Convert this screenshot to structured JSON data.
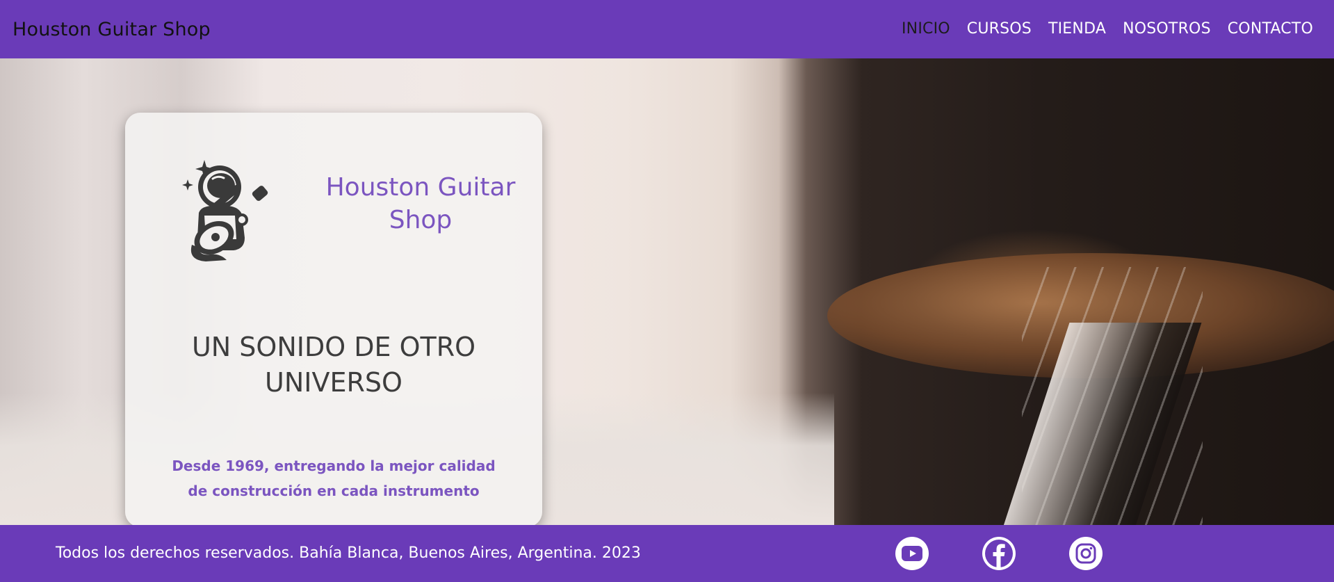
{
  "header": {
    "brand": "Houston Guitar Shop",
    "nav": [
      {
        "label": "INICIO",
        "active": true
      },
      {
        "label": "CURSOS",
        "active": false
      },
      {
        "label": "TIENDA",
        "active": false
      },
      {
        "label": "NOSOTROS",
        "active": false
      },
      {
        "label": "CONTACTO",
        "active": false
      }
    ]
  },
  "card": {
    "title": "Houston Guitar Shop",
    "logo_icon": "astronaut-guitar-logo",
    "tagline": "UN SONIDO DE OTRO UNIVERSO",
    "description": "Desde 1969, entregando la mejor calidad de construcción en cada instrumento"
  },
  "footer": {
    "text": "Todos los derechos reservados. Bahía Blanca, Buenos Aires, Argentina. 2023",
    "social": [
      {
        "icon": "youtube-icon"
      },
      {
        "icon": "facebook-icon"
      },
      {
        "icon": "instagram-icon"
      }
    ]
  },
  "colors": {
    "brand_purple": "#6a3bb8",
    "accent_purple": "#7b55c0",
    "nav_active": "#1c1c1c",
    "nav_text": "#ffffff"
  }
}
